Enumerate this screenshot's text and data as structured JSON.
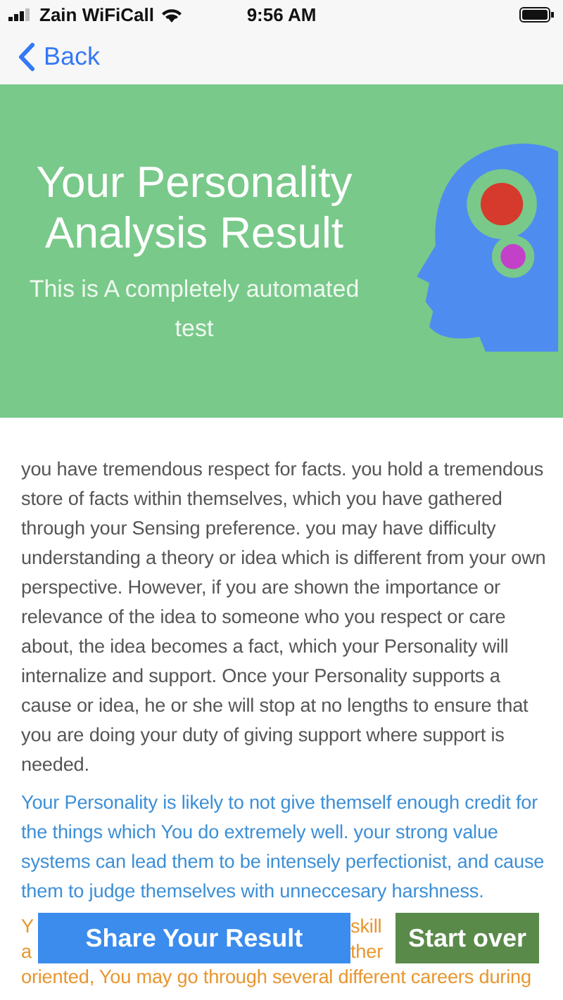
{
  "status_bar": {
    "carrier": "Zain WiFiCall",
    "time": "9:56 AM"
  },
  "nav": {
    "back": "Back"
  },
  "banner": {
    "title": "Your Personality Analysis Result",
    "subtitle": "This is A completely automated test"
  },
  "paragraphs": [
    {
      "kind": "full",
      "color": "#555555",
      "text": "you have tremendous respect for facts. you hold a tremendous store of facts within themselves, which you have gathered through your Sensing preference. you may have difficulty understanding a theory or idea which is different from your own perspective. However, if you are shown the importance or relevance of the idea to someone who you respect or care about, the idea becomes a fact, which your Personality will internalize and support. Once your Personality supports a cause or idea, he or she will stop at no lengths to ensure that you are doing your duty of giving support where support is needed."
    },
    {
      "kind": "full",
      "color": "#3d8fd6",
      "text": "Your Personality is likely to not give themself enough credit for the things which You do extremely well. your strong value systems can lead them to be intensely perfectionist, and cause them to judge themselves with unneccesary harshness."
    },
    {
      "kind": "covered",
      "color": "#e8962e",
      "lines": [
        [
          "Y",
          "skill"
        ],
        [
          "a",
          "ther"
        ],
        [
          "oriented, You may go through several different careers during"
        ]
      ]
    }
  ],
  "buttons": [
    {
      "kind": "share",
      "label": "Share Your Result"
    },
    {
      "kind": "restart",
      "label": "Start over"
    }
  ]
}
